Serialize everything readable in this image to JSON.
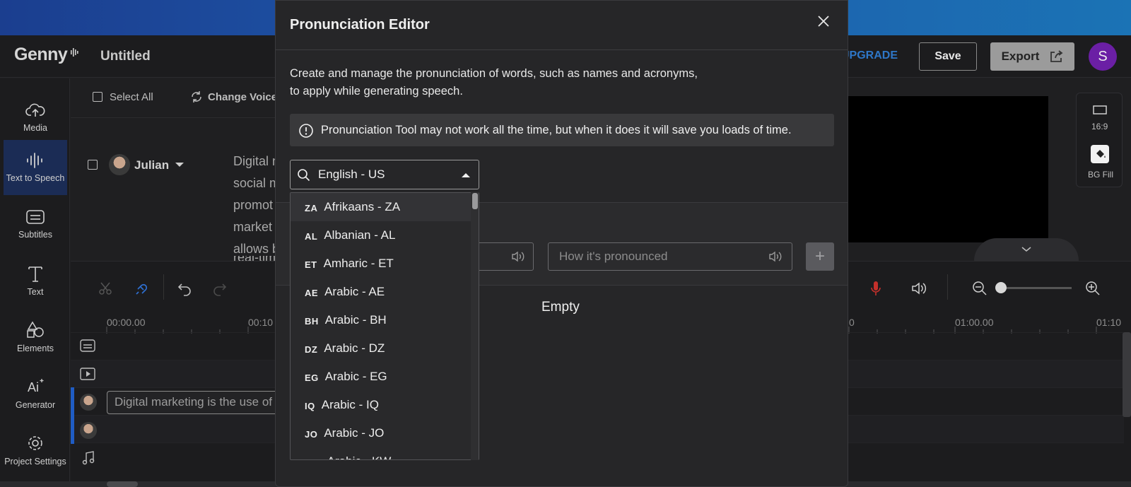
{
  "header": {
    "logo": "Genny",
    "doc_title": "Untitled",
    "upgrade": "UPGRADE",
    "save": "Save",
    "export": "Export",
    "avatar_initial": "S",
    "colors": {
      "top_strip": "#1d56a8",
      "upgrade": "#2e77c8",
      "avatar": "#6b1fa5"
    }
  },
  "sidebar": {
    "items": [
      {
        "label": "Media",
        "icon": "cloud-upload-icon"
      },
      {
        "label": "Text to Speech",
        "icon": "audio-wave-icon"
      },
      {
        "label": "Subtitles",
        "icon": "subtitles-icon"
      },
      {
        "label": "Text",
        "icon": "text-icon"
      },
      {
        "label": "Elements",
        "icon": "shapes-icon"
      },
      {
        "label": "Generator",
        "icon": "ai-icon"
      },
      {
        "label": "Project Settings",
        "icon": "gear-icon"
      }
    ]
  },
  "editor": {
    "select_all": "Select All",
    "change_voice": "Change Voice",
    "voice_name": "Julian",
    "script_lines": [
      "Digital m",
      "social m",
      "promot",
      "market",
      "allows b",
      "real-tim"
    ]
  },
  "right_panel": {
    "ratio": "16:9",
    "bg_fill": "BG Fill"
  },
  "timeline": {
    "time_labels": [
      "00:00.00",
      "00:10",
      "0",
      "01:00.00",
      "01:10"
    ],
    "text_clip": "Digital marketing is the use of"
  },
  "modal": {
    "title": "Pronunciation Editor",
    "description_line1": "Create and manage the pronunciation of words, such as names and acronyms,",
    "description_line2": "to apply while generating speech.",
    "info": "Pronunciation Tool may not work all the time, but when it does it will save you loads of time.",
    "language_selected": "English - US",
    "pronounced_placeholder": "How it's pronounced",
    "add_label": "+",
    "empty": "Empty",
    "languages": [
      {
        "code": "ZA",
        "name": "Afrikaans - ZA"
      },
      {
        "code": "AL",
        "name": "Albanian - AL"
      },
      {
        "code": "ET",
        "name": "Amharic - ET"
      },
      {
        "code": "AE",
        "name": "Arabic - AE"
      },
      {
        "code": "BH",
        "name": "Arabic - BH"
      },
      {
        "code": "DZ",
        "name": "Arabic - DZ"
      },
      {
        "code": "EG",
        "name": "Arabic - EG"
      },
      {
        "code": "IQ",
        "name": "Arabic - IQ"
      },
      {
        "code": "JO",
        "name": "Arabic - JO"
      },
      {
        "code": "KW",
        "name": "Arabic - KW"
      }
    ]
  }
}
